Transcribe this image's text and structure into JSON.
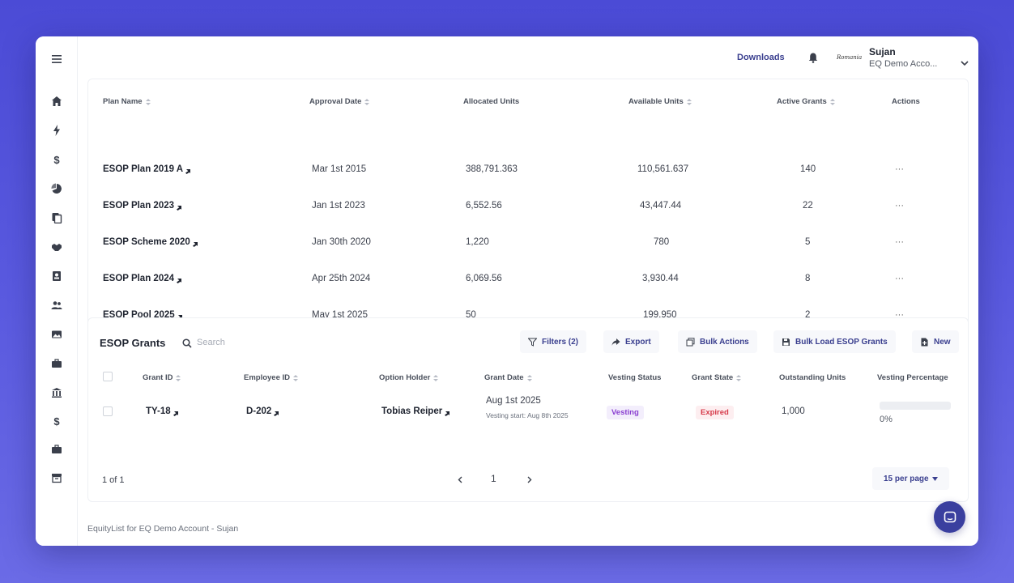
{
  "topbar": {
    "downloads_label": "Downloads",
    "brand_logo_text": "Romania",
    "user_name": "Sujan",
    "user_account": "EQ Demo Acco..."
  },
  "sidebar": {
    "icons": [
      "menu-icon",
      "home-icon",
      "lightning-icon",
      "dollar-icon",
      "pie-chart-icon",
      "documents-icon",
      "handshake-icon",
      "user-badge-icon",
      "users-icon",
      "image-icon",
      "briefcase-icon",
      "bank-icon",
      "dollar-icon",
      "briefcase-icon",
      "archive-icon"
    ]
  },
  "plans": {
    "columns": {
      "plan_name": "Plan Name",
      "approval_date": "Approval Date",
      "allocated_units": "Allocated Units",
      "available_units": "Available Units",
      "active_grants": "Active Grants",
      "actions": "Actions"
    },
    "rows": [
      {
        "name": "ESOP Plan 2019 A",
        "approval": "Mar 1st 2015",
        "allocated": "388,791.363",
        "available": "110,561.637",
        "active": "140",
        "actions": "···"
      },
      {
        "name": "ESOP Plan 2023",
        "approval": "Jan 1st 2023",
        "allocated": "6,552.56",
        "available": "43,447.44",
        "active": "22",
        "actions": "···"
      },
      {
        "name": "ESOP Scheme 2020",
        "approval": "Jan 30th 2020",
        "allocated": "1,220",
        "available": "780",
        "active": "5",
        "actions": "···"
      },
      {
        "name": "ESOP Plan 2024",
        "approval": "Apr 25th 2024",
        "allocated": "6,069.56",
        "available": "3,930.44",
        "active": "8",
        "actions": "···"
      },
      {
        "name": "ESOP Pool 2025",
        "approval": "May 1st 2025",
        "allocated": "50",
        "available": "199,950",
        "active": "2",
        "actions": "···"
      }
    ]
  },
  "grants": {
    "title": "ESOP Grants",
    "search_placeholder": "Search",
    "toolbar": {
      "filters": "Filters (2)",
      "export": "Export",
      "bulk_actions": "Bulk Actions",
      "bulk_load": "Bulk Load ESOP Grants",
      "new": "New"
    },
    "columns": {
      "grant_id": "Grant ID",
      "employee_id": "Employee ID",
      "option_holder": "Option Holder",
      "grant_date": "Grant Date",
      "vesting_status": "Vesting Status",
      "grant_state": "Grant State",
      "outstanding_units": "Outstanding Units",
      "vesting_percentage": "Vesting Percentage"
    },
    "row": {
      "grant_id": "TY-18",
      "employee_id": "D-202",
      "option_holder": "Tobias Reiper",
      "grant_date": "Aug 1st 2025",
      "vesting_start": "Vesting start: Aug 8th 2025",
      "vesting_status": "Vesting",
      "grant_state": "Expired",
      "outstanding_units": "1,000",
      "vesting_fraction": 0,
      "vesting_percentage": "0%"
    },
    "pagination": {
      "info": "1 of 1",
      "current_page": "1",
      "per_page": "15 per page"
    }
  },
  "footer": {
    "text": "EquityList for EQ Demo Account - Sujan"
  },
  "colors": {
    "accent": "#3a3f8f",
    "background_gradient_top": "#4b4bd6",
    "vesting_badge": "#8a3fd1",
    "expired_badge": "#d63a4a",
    "chat_fab": "#3a3f9f"
  }
}
